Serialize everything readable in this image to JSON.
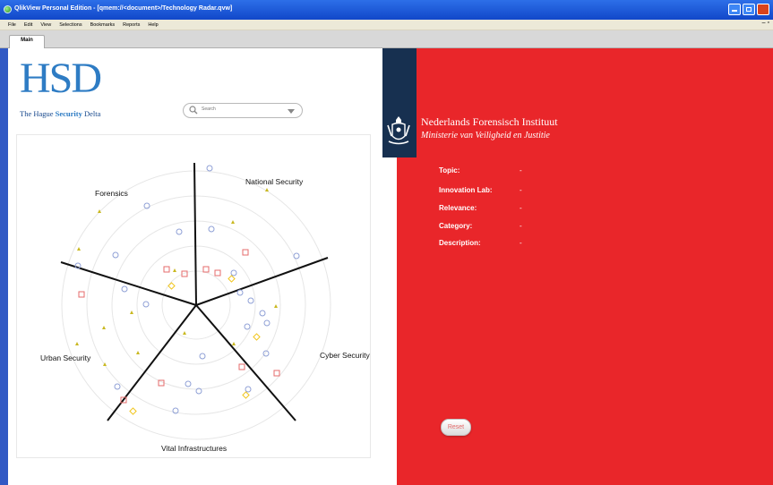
{
  "window": {
    "title": "QlikView Personal Edition - [qmem://<document>/Technology Radar.qvw]"
  },
  "menu": {
    "items": [
      "File",
      "Edit",
      "View",
      "Selections",
      "Bookmarks",
      "Reports",
      "Help"
    ],
    "mdi_controls": "– ♬"
  },
  "tabs": [
    {
      "label": "Main"
    }
  ],
  "logo": {
    "text": "HSD",
    "subtitle_plain": "The Hague ",
    "subtitle_bold": "Security",
    "subtitle_end": " Delta"
  },
  "search": {
    "placeholder": "Search"
  },
  "radar": {
    "sectors": [
      "National Security",
      "Cyber Security",
      "Vital Infrastructures",
      "Urban Security",
      "Forensics"
    ],
    "colors": {
      "circle": "#8fa0d6",
      "square": "#e56b6b",
      "diamond": "#f0c419",
      "triangle": "#c9b820"
    }
  },
  "nfi": {
    "title": "Nederlands Forensisch Instituut",
    "subtitle": "Ministerie van Veiligheid en Justitie"
  },
  "details": [
    {
      "label": "Topic:",
      "value": "-"
    },
    {
      "label": "Innovation Lab:",
      "value": "-"
    },
    {
      "label": "Relevance:",
      "value": "-"
    },
    {
      "label": "Category:",
      "value": "-"
    },
    {
      "label": "Description:",
      "value": "-"
    }
  ],
  "reset_label": "Reset",
  "colors": {
    "accent_red": "#e9262a",
    "navy": "#173050",
    "hsd_blue": "#2e7cc4"
  }
}
